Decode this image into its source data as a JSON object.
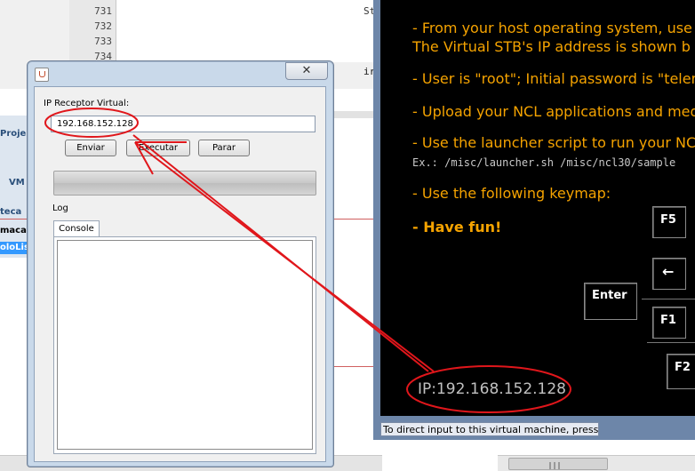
{
  "editor": {
    "line_numbers": [
      "731",
      "732",
      "733",
      "734"
    ],
    "code_fragments": [
      "St",
      "ir"
    ],
    "left_panel": {
      "projects_tab": "Proje",
      "vm_tab": "VM",
      "section_header": "teca",
      "item_1": "maca",
      "item_2_selected": "oloList"
    }
  },
  "vm_window": {
    "lines": [
      "- From your host operating system, use S",
      "The Virtual STB's IP address is shown b",
      "- User is \"root\"; Initial password is \"telem",
      "- Upload your NCL applications and medi",
      "- Use the launcher script to run your NCL"
    ],
    "example": "Ex.: /misc/launcher.sh /misc/ncl30/sample",
    "keymap_line": "- Use the following keymap:",
    "fun_line": "- Have fun!",
    "keys": {
      "f5": "F5",
      "backspace": "←",
      "enter": "Enter",
      "f1": "F1",
      "f2": "F2"
    },
    "ip_display": "IP:192.168.152.128",
    "status_bar": "To direct input to this virtual machine, press Ctrl+G."
  },
  "dialog": {
    "close_glyph": "✕",
    "ip_label": "IP Receptor Virtual:",
    "ip_value": "192.168.152.128",
    "buttons": {
      "send": "Enviar",
      "execute": "Executar",
      "stop": "Parar"
    },
    "log_label": "Log",
    "console_tab": "Console",
    "console_text": ""
  },
  "colors": {
    "vm_text": "#f5a300",
    "annotation_red": "#e0161b",
    "dialog_frame": "#c9d9ea"
  }
}
